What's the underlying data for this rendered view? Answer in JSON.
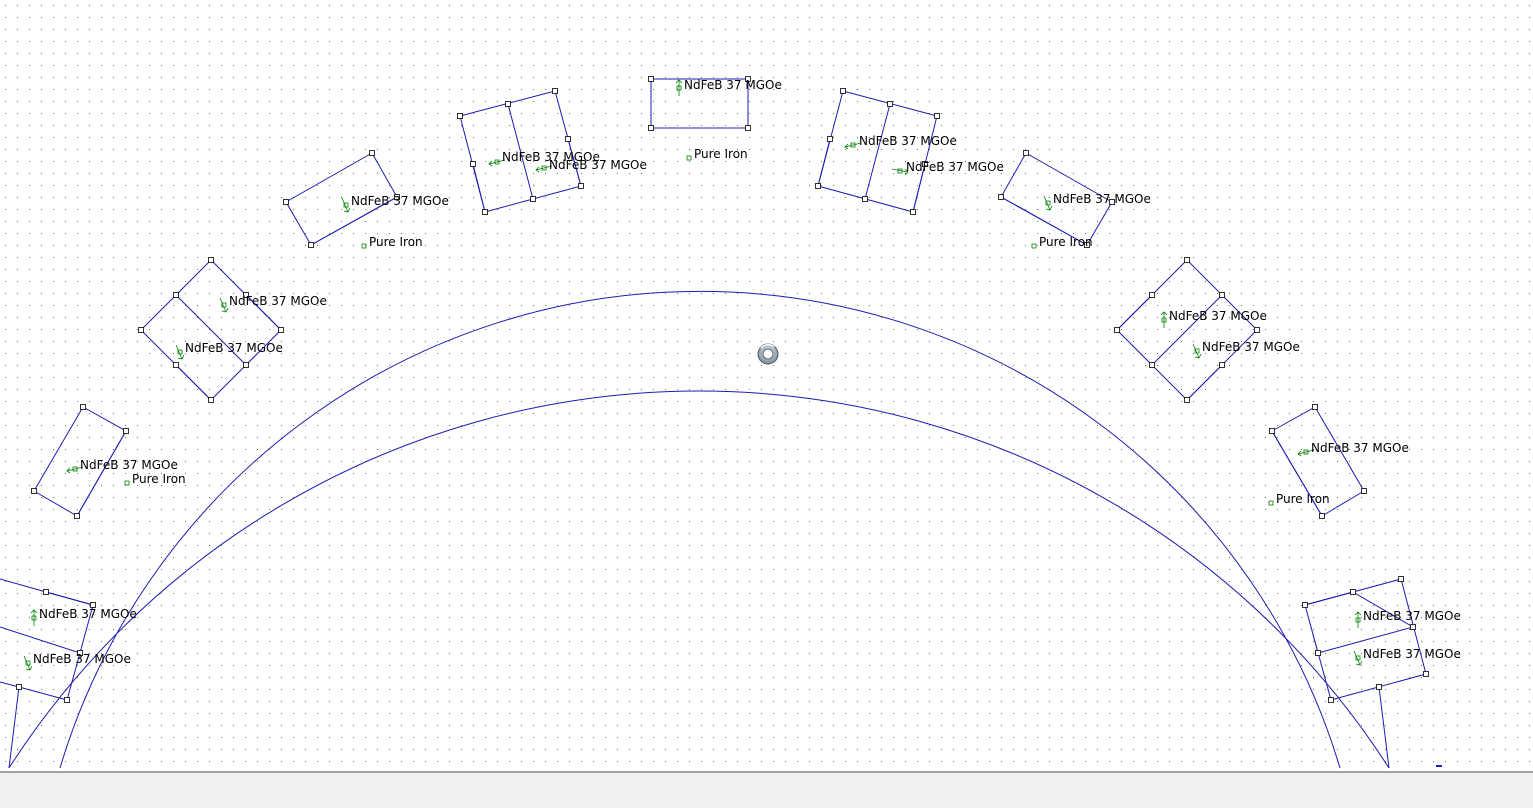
{
  "viewer": {
    "material_magnet": "NdFeB 37 MGOe",
    "material_iron": "Pure Iron",
    "colors": {
      "background": "#ffffff",
      "grid_dot": "#6e6e6e",
      "geometry": "#1c1cb4",
      "block_marker": "#008000",
      "label_text": "#000000",
      "statusbar": "#f0f0f0"
    },
    "icons": {
      "center_cursor": "spinner-ring-icon",
      "magnetization_marker": "arrow-marker-icon"
    }
  }
}
